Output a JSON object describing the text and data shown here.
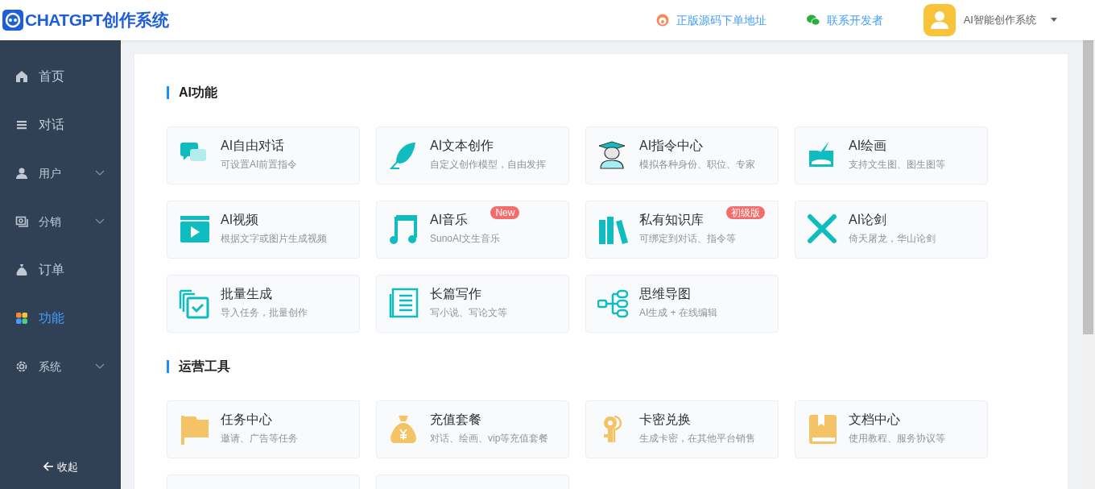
{
  "header": {
    "logo_text": "CHATGPT创作系统",
    "links": [
      {
        "label": "正版源码下单地址"
      },
      {
        "label": "联系开发者"
      }
    ],
    "user": {
      "name": "AI智能创作系统"
    }
  },
  "sidebar": {
    "items": [
      {
        "label": "首页",
        "selected": false,
        "has_submenu": false
      },
      {
        "label": "对话",
        "selected": false,
        "has_submenu": false
      },
      {
        "label": "用户",
        "selected": false,
        "has_submenu": true
      },
      {
        "label": "分销",
        "selected": false,
        "has_submenu": true
      },
      {
        "label": "订单",
        "selected": false,
        "has_submenu": false
      },
      {
        "label": "功能",
        "selected": true,
        "has_submenu": false
      },
      {
        "label": "系统",
        "selected": false,
        "has_submenu": true
      }
    ],
    "collapse": "收起"
  },
  "sections": [
    {
      "title": "AI功能",
      "cards": [
        {
          "title": "AI自由对话",
          "desc": "可设置AI前置指令"
        },
        {
          "title": "AI文本创作",
          "desc": "自定义创作模型，自由发挥"
        },
        {
          "title": "AI指令中心",
          "desc": "模拟各种身份、职位、专家"
        },
        {
          "title": "AI绘画",
          "desc": "支持文生图、图生图等"
        },
        {
          "title": "AI视频",
          "desc": "根据文字或图片生成视频"
        },
        {
          "title": "AI音乐",
          "desc": "SunoAI文生音乐",
          "badge": "New"
        },
        {
          "title": "私有知识库",
          "desc": "可绑定到对话、指令等",
          "badge": "初级版"
        },
        {
          "title": "AI论剑",
          "desc": "倚天屠龙，华山论剑"
        },
        {
          "title": "批量生成",
          "desc": "导入任务，批量创作"
        },
        {
          "title": "长篇写作",
          "desc": "写小说、写论文等"
        },
        {
          "title": "思维导图",
          "desc": "AI生成 + 在线编辑"
        }
      ]
    },
    {
      "title": "运营工具",
      "cards": [
        {
          "title": "任务中心",
          "desc": "邀请、广告等任务"
        },
        {
          "title": "充值套餐",
          "desc": "对话、绘画、vip等充值套餐"
        },
        {
          "title": "卡密兑换",
          "desc": "生成卡密，在其他平台销售"
        },
        {
          "title": "文档中心",
          "desc": "使用教程、服务协议等"
        },
        {
          "cut_off": true
        },
        {
          "cut_off": true
        }
      ]
    }
  ]
}
